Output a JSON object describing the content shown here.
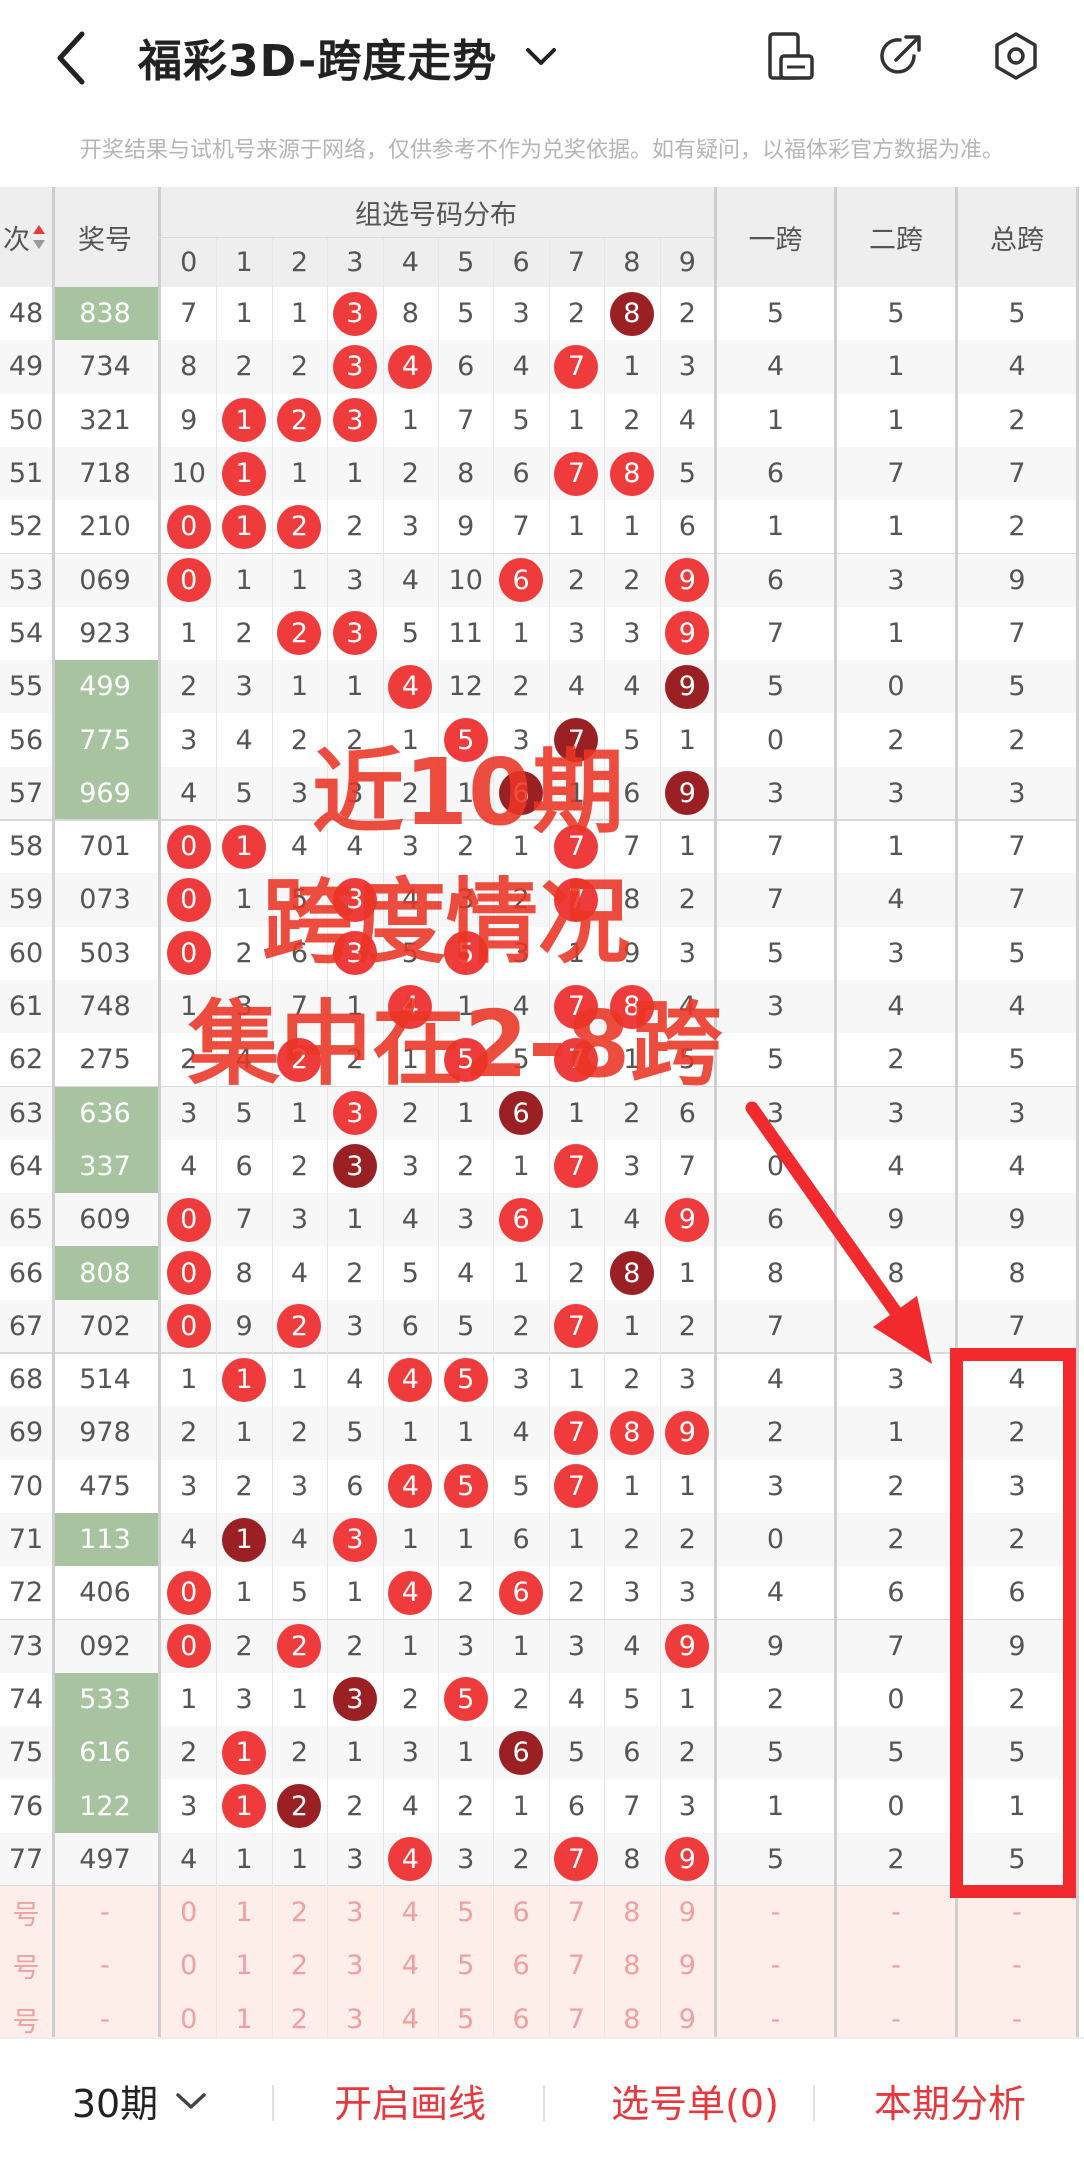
{
  "header": {
    "title": "福彩3D-跨度走势",
    "back_icon": "chevron-left-icon",
    "title_dropdown_icon": "chevron-down-icon",
    "actions": [
      {
        "name": "layout-toggle-icon"
      },
      {
        "name": "share-icon"
      },
      {
        "name": "settings-icon"
      }
    ]
  },
  "notice": "开奖结果与试机号来源于网络，仅供参考不作为兑奖依据。如有疑问，以福体彩官方数据为准。",
  "table": {
    "period_header": "次",
    "prize_header": "奖号",
    "distribution_header": "组选号码分布",
    "digits": [
      "0",
      "1",
      "2",
      "3",
      "4",
      "5",
      "6",
      "7",
      "8",
      "9"
    ],
    "span_headers": [
      "一跨",
      "二跨",
      "总跨"
    ],
    "rows": [
      {
        "p": "48",
        "prize": "838",
        "hl": true,
        "d": [
          7,
          1,
          1,
          "r",
          8,
          5,
          3,
          2,
          "d",
          2
        ],
        "s": [
          5,
          5,
          5
        ]
      },
      {
        "p": "49",
        "prize": "734",
        "hl": false,
        "d": [
          8,
          2,
          2,
          "r",
          "r",
          6,
          4,
          "r",
          1,
          3
        ],
        "s": [
          4,
          1,
          4
        ]
      },
      {
        "p": "50",
        "prize": "321",
        "hl": false,
        "d": [
          9,
          "r",
          "r",
          "r",
          1,
          7,
          5,
          1,
          2,
          4
        ],
        "s": [
          1,
          1,
          2
        ]
      },
      {
        "p": "51",
        "prize": "718",
        "hl": false,
        "d": [
          10,
          "r",
          1,
          1,
          2,
          8,
          6,
          "r",
          "r",
          5
        ],
        "s": [
          6,
          7,
          7
        ]
      },
      {
        "p": "52",
        "prize": "210",
        "hl": false,
        "d": [
          "r",
          "r",
          "r",
          2,
          3,
          9,
          7,
          1,
          1,
          6
        ],
        "s": [
          1,
          1,
          2
        ]
      },
      {
        "p": "53",
        "prize": "069",
        "hl": false,
        "d": [
          "r",
          1,
          1,
          3,
          4,
          10,
          "r",
          2,
          2,
          "r"
        ],
        "s": [
          6,
          3,
          9
        ]
      },
      {
        "p": "54",
        "prize": "923",
        "hl": false,
        "d": [
          1,
          2,
          "r",
          "r",
          5,
          11,
          1,
          3,
          3,
          "r"
        ],
        "s": [
          7,
          1,
          7
        ]
      },
      {
        "p": "55",
        "prize": "499",
        "hl": true,
        "d": [
          2,
          3,
          1,
          1,
          "r",
          12,
          2,
          4,
          4,
          "d"
        ],
        "s": [
          5,
          0,
          5
        ]
      },
      {
        "p": "56",
        "prize": "775",
        "hl": true,
        "d": [
          3,
          4,
          2,
          2,
          1,
          "r",
          3,
          "d",
          5,
          1
        ],
        "s": [
          0,
          2,
          2
        ]
      },
      {
        "p": "57",
        "prize": "969",
        "hl": true,
        "d": [
          4,
          5,
          3,
          3,
          2,
          1,
          "d",
          1,
          6,
          "d"
        ],
        "s": [
          3,
          3,
          3
        ]
      },
      {
        "p": "58",
        "prize": "701",
        "hl": false,
        "d": [
          "r",
          "r",
          4,
          4,
          3,
          2,
          1,
          "r",
          7,
          1
        ],
        "s": [
          7,
          1,
          7
        ]
      },
      {
        "p": "59",
        "prize": "073",
        "hl": false,
        "d": [
          "r",
          1,
          5,
          "r",
          4,
          3,
          2,
          "r",
          8,
          2
        ],
        "s": [
          7,
          4,
          7
        ]
      },
      {
        "p": "60",
        "prize": "503",
        "hl": false,
        "d": [
          "r",
          2,
          6,
          "r",
          5,
          "r",
          3,
          1,
          9,
          3
        ],
        "s": [
          5,
          3,
          5
        ]
      },
      {
        "p": "61",
        "prize": "748",
        "hl": false,
        "d": [
          1,
          3,
          7,
          1,
          "r",
          1,
          4,
          "r",
          "r",
          4
        ],
        "s": [
          3,
          4,
          4
        ]
      },
      {
        "p": "62",
        "prize": "275",
        "hl": false,
        "d": [
          2,
          4,
          "r",
          2,
          1,
          "r",
          5,
          "r",
          1,
          5
        ],
        "s": [
          5,
          2,
          5
        ]
      },
      {
        "p": "63",
        "prize": "636",
        "hl": true,
        "d": [
          3,
          5,
          1,
          "r",
          2,
          1,
          "d",
          1,
          2,
          6
        ],
        "s": [
          3,
          3,
          3
        ]
      },
      {
        "p": "64",
        "prize": "337",
        "hl": true,
        "d": [
          4,
          6,
          2,
          "d",
          3,
          2,
          1,
          "r",
          3,
          7
        ],
        "s": [
          0,
          4,
          4
        ]
      },
      {
        "p": "65",
        "prize": "609",
        "hl": false,
        "d": [
          "r",
          7,
          3,
          1,
          4,
          3,
          "r",
          1,
          4,
          "r"
        ],
        "s": [
          6,
          9,
          9
        ]
      },
      {
        "p": "66",
        "prize": "808",
        "hl": true,
        "d": [
          "r",
          8,
          4,
          2,
          5,
          4,
          1,
          2,
          "d",
          1
        ],
        "s": [
          8,
          8,
          8
        ]
      },
      {
        "p": "67",
        "prize": "702",
        "hl": false,
        "d": [
          "r",
          9,
          "r",
          3,
          6,
          5,
          2,
          "r",
          1,
          2
        ],
        "s": [
          7,
          2,
          7
        ]
      },
      {
        "p": "68",
        "prize": "514",
        "hl": false,
        "d": [
          1,
          "r",
          1,
          4,
          "r",
          "r",
          3,
          1,
          2,
          3
        ],
        "s": [
          4,
          3,
          4
        ]
      },
      {
        "p": "69",
        "prize": "978",
        "hl": false,
        "d": [
          2,
          1,
          2,
          5,
          1,
          1,
          4,
          "r",
          "r",
          "r"
        ],
        "s": [
          2,
          1,
          2
        ]
      },
      {
        "p": "70",
        "prize": "475",
        "hl": false,
        "d": [
          3,
          2,
          3,
          6,
          "r",
          "r",
          5,
          "r",
          1,
          1
        ],
        "s": [
          3,
          2,
          3
        ]
      },
      {
        "p": "71",
        "prize": "113",
        "hl": true,
        "d": [
          4,
          "d",
          4,
          "r",
          1,
          1,
          6,
          1,
          2,
          2
        ],
        "s": [
          0,
          2,
          2
        ]
      },
      {
        "p": "72",
        "prize": "406",
        "hl": false,
        "d": [
          "r",
          1,
          5,
          1,
          "r",
          2,
          "r",
          2,
          3,
          3
        ],
        "s": [
          4,
          6,
          6
        ]
      },
      {
        "p": "73",
        "prize": "092",
        "hl": false,
        "d": [
          "r",
          2,
          "r",
          2,
          1,
          3,
          1,
          3,
          4,
          "r"
        ],
        "s": [
          9,
          7,
          9
        ]
      },
      {
        "p": "74",
        "prize": "533",
        "hl": true,
        "d": [
          1,
          3,
          1,
          "d",
          2,
          "r",
          2,
          4,
          5,
          1
        ],
        "s": [
          2,
          0,
          2
        ]
      },
      {
        "p": "75",
        "prize": "616",
        "hl": true,
        "d": [
          2,
          "r",
          2,
          1,
          3,
          1,
          "d",
          5,
          6,
          2
        ],
        "s": [
          5,
          5,
          5
        ]
      },
      {
        "p": "76",
        "prize": "122",
        "hl": true,
        "d": [
          3,
          "r",
          "d",
          2,
          4,
          2,
          1,
          6,
          7,
          3
        ],
        "s": [
          1,
          0,
          1
        ]
      },
      {
        "p": "77",
        "prize": "497",
        "hl": false,
        "d": [
          4,
          1,
          1,
          3,
          "r",
          3,
          2,
          "r",
          8,
          "r"
        ],
        "s": [
          5,
          2,
          5
        ]
      }
    ],
    "stat_rows": [
      {
        "label": "号",
        "prize": "-",
        "d": [
          "0",
          "1",
          "2",
          "3",
          "4",
          "5",
          "6",
          "7",
          "8",
          "9"
        ],
        "s": [
          "-",
          "-",
          "-"
        ]
      },
      {
        "label": "号",
        "prize": "-",
        "d": [
          "0",
          "1",
          "2",
          "3",
          "4",
          "5",
          "6",
          "7",
          "8",
          "9"
        ],
        "s": [
          "-",
          "-",
          "-"
        ]
      },
      {
        "label": "号",
        "prize": "-",
        "d": [
          "0",
          "1",
          "2",
          "3",
          "4",
          "5",
          "6",
          "7",
          "8",
          "9"
        ],
        "s": [
          "-",
          "-",
          "-"
        ]
      }
    ]
  },
  "overlay": {
    "line1": "近10期",
    "line2": "跨度情况",
    "line3": "集中在2-8跨"
  },
  "bottom_bar": {
    "period_select": "30期",
    "draw_line": "开启画线",
    "pick_list": "选号单(0)",
    "analysis": "本期分析"
  },
  "colors": {
    "ball_red": "#ef3b3b",
    "ball_dark": "#9b2024",
    "prize_highlight": "#a8c39f",
    "accent": "#e8383d"
  }
}
